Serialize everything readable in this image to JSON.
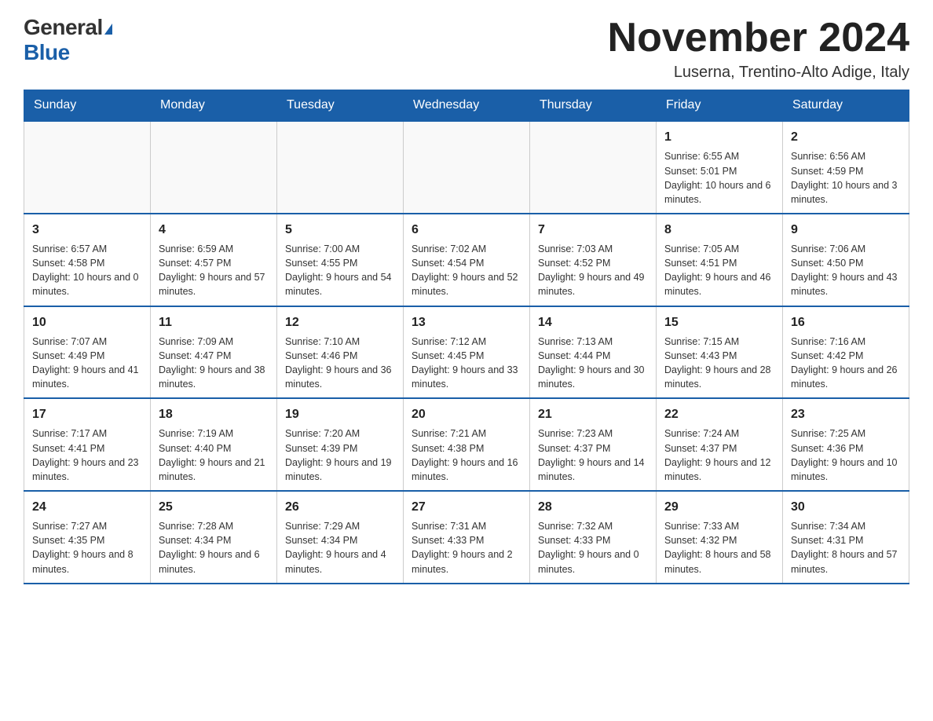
{
  "logo": {
    "general": "General",
    "blue": "Blue"
  },
  "title": "November 2024",
  "location": "Luserna, Trentino-Alto Adige, Italy",
  "days_of_week": [
    "Sunday",
    "Monday",
    "Tuesday",
    "Wednesday",
    "Thursday",
    "Friday",
    "Saturday"
  ],
  "weeks": [
    [
      {
        "day": "",
        "info": ""
      },
      {
        "day": "",
        "info": ""
      },
      {
        "day": "",
        "info": ""
      },
      {
        "day": "",
        "info": ""
      },
      {
        "day": "",
        "info": ""
      },
      {
        "day": "1",
        "info": "Sunrise: 6:55 AM\nSunset: 5:01 PM\nDaylight: 10 hours and 6 minutes."
      },
      {
        "day": "2",
        "info": "Sunrise: 6:56 AM\nSunset: 4:59 PM\nDaylight: 10 hours and 3 minutes."
      }
    ],
    [
      {
        "day": "3",
        "info": "Sunrise: 6:57 AM\nSunset: 4:58 PM\nDaylight: 10 hours and 0 minutes."
      },
      {
        "day": "4",
        "info": "Sunrise: 6:59 AM\nSunset: 4:57 PM\nDaylight: 9 hours and 57 minutes."
      },
      {
        "day": "5",
        "info": "Sunrise: 7:00 AM\nSunset: 4:55 PM\nDaylight: 9 hours and 54 minutes."
      },
      {
        "day": "6",
        "info": "Sunrise: 7:02 AM\nSunset: 4:54 PM\nDaylight: 9 hours and 52 minutes."
      },
      {
        "day": "7",
        "info": "Sunrise: 7:03 AM\nSunset: 4:52 PM\nDaylight: 9 hours and 49 minutes."
      },
      {
        "day": "8",
        "info": "Sunrise: 7:05 AM\nSunset: 4:51 PM\nDaylight: 9 hours and 46 minutes."
      },
      {
        "day": "9",
        "info": "Sunrise: 7:06 AM\nSunset: 4:50 PM\nDaylight: 9 hours and 43 minutes."
      }
    ],
    [
      {
        "day": "10",
        "info": "Sunrise: 7:07 AM\nSunset: 4:49 PM\nDaylight: 9 hours and 41 minutes."
      },
      {
        "day": "11",
        "info": "Sunrise: 7:09 AM\nSunset: 4:47 PM\nDaylight: 9 hours and 38 minutes."
      },
      {
        "day": "12",
        "info": "Sunrise: 7:10 AM\nSunset: 4:46 PM\nDaylight: 9 hours and 36 minutes."
      },
      {
        "day": "13",
        "info": "Sunrise: 7:12 AM\nSunset: 4:45 PM\nDaylight: 9 hours and 33 minutes."
      },
      {
        "day": "14",
        "info": "Sunrise: 7:13 AM\nSunset: 4:44 PM\nDaylight: 9 hours and 30 minutes."
      },
      {
        "day": "15",
        "info": "Sunrise: 7:15 AM\nSunset: 4:43 PM\nDaylight: 9 hours and 28 minutes."
      },
      {
        "day": "16",
        "info": "Sunrise: 7:16 AM\nSunset: 4:42 PM\nDaylight: 9 hours and 26 minutes."
      }
    ],
    [
      {
        "day": "17",
        "info": "Sunrise: 7:17 AM\nSunset: 4:41 PM\nDaylight: 9 hours and 23 minutes."
      },
      {
        "day": "18",
        "info": "Sunrise: 7:19 AM\nSunset: 4:40 PM\nDaylight: 9 hours and 21 minutes."
      },
      {
        "day": "19",
        "info": "Sunrise: 7:20 AM\nSunset: 4:39 PM\nDaylight: 9 hours and 19 minutes."
      },
      {
        "day": "20",
        "info": "Sunrise: 7:21 AM\nSunset: 4:38 PM\nDaylight: 9 hours and 16 minutes."
      },
      {
        "day": "21",
        "info": "Sunrise: 7:23 AM\nSunset: 4:37 PM\nDaylight: 9 hours and 14 minutes."
      },
      {
        "day": "22",
        "info": "Sunrise: 7:24 AM\nSunset: 4:37 PM\nDaylight: 9 hours and 12 minutes."
      },
      {
        "day": "23",
        "info": "Sunrise: 7:25 AM\nSunset: 4:36 PM\nDaylight: 9 hours and 10 minutes."
      }
    ],
    [
      {
        "day": "24",
        "info": "Sunrise: 7:27 AM\nSunset: 4:35 PM\nDaylight: 9 hours and 8 minutes."
      },
      {
        "day": "25",
        "info": "Sunrise: 7:28 AM\nSunset: 4:34 PM\nDaylight: 9 hours and 6 minutes."
      },
      {
        "day": "26",
        "info": "Sunrise: 7:29 AM\nSunset: 4:34 PM\nDaylight: 9 hours and 4 minutes."
      },
      {
        "day": "27",
        "info": "Sunrise: 7:31 AM\nSunset: 4:33 PM\nDaylight: 9 hours and 2 minutes."
      },
      {
        "day": "28",
        "info": "Sunrise: 7:32 AM\nSunset: 4:33 PM\nDaylight: 9 hours and 0 minutes."
      },
      {
        "day": "29",
        "info": "Sunrise: 7:33 AM\nSunset: 4:32 PM\nDaylight: 8 hours and 58 minutes."
      },
      {
        "day": "30",
        "info": "Sunrise: 7:34 AM\nSunset: 4:31 PM\nDaylight: 8 hours and 57 minutes."
      }
    ]
  ]
}
